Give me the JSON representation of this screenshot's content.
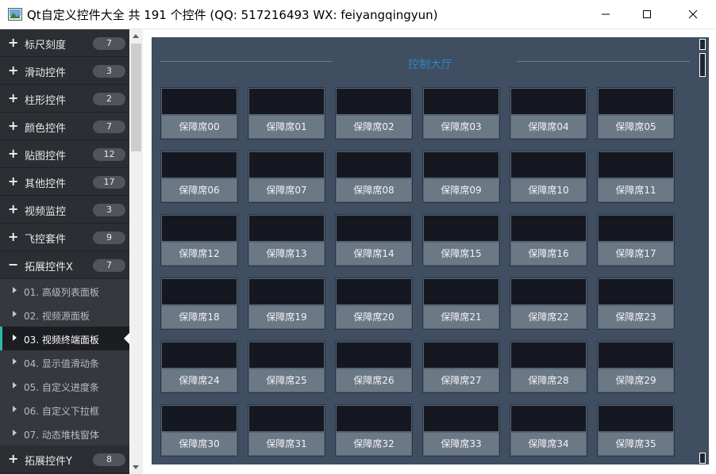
{
  "window": {
    "title": "Qt自定义控件大全 共 191 个控件 (QQ: 517216493 WX: feiyangqingyun)",
    "icon": "app-picture-icon"
  },
  "sidebar": {
    "parents_top": [
      {
        "label": "标尺刻度",
        "count": "7"
      },
      {
        "label": "滑动控件",
        "count": "3"
      },
      {
        "label": "柱形控件",
        "count": "2"
      },
      {
        "label": "颜色控件",
        "count": "7"
      },
      {
        "label": "贴图控件",
        "count": "12"
      },
      {
        "label": "其他控件",
        "count": "17"
      },
      {
        "label": "视频监控",
        "count": "3"
      },
      {
        "label": "飞控套件",
        "count": "9"
      }
    ],
    "expanded": {
      "label": "拓展控件X",
      "count": "7",
      "icon": "minus"
    },
    "children": [
      {
        "label": "01. 高级列表面板"
      },
      {
        "label": "02. 视频源面板"
      },
      {
        "label": "03. 视频终端面板"
      },
      {
        "label": "04. 显示值滑动条"
      },
      {
        "label": "05. 自定义进度条"
      },
      {
        "label": "06. 自定义下拉框"
      },
      {
        "label": "07. 动态堆栈窗体"
      }
    ],
    "active_child_index": 2,
    "parents_bottom": [
      {
        "label": "拓展控件Y",
        "count": "8"
      }
    ]
  },
  "main": {
    "title": "控制大厅",
    "seats": [
      "保障席00",
      "保障席01",
      "保障席02",
      "保障席03",
      "保障席04",
      "保障席05",
      "保障席06",
      "保障席07",
      "保障席08",
      "保障席09",
      "保障席10",
      "保障席11",
      "保障席12",
      "保障席13",
      "保障席14",
      "保障席15",
      "保障席16",
      "保障席17",
      "保障席18",
      "保障席19",
      "保障席20",
      "保障席21",
      "保障席22",
      "保障席23",
      "保障席24",
      "保障席25",
      "保障席26",
      "保障席27",
      "保障席28",
      "保障席29",
      "保障席30",
      "保障席31",
      "保障席32",
      "保障席33",
      "保障席34",
      "保障席35"
    ]
  },
  "colors": {
    "sidebar_bg": "#2b2e33",
    "active_accent": "#2fb8a6",
    "panel_bg": "#3f4e60",
    "title_blue": "#2f84c8"
  }
}
